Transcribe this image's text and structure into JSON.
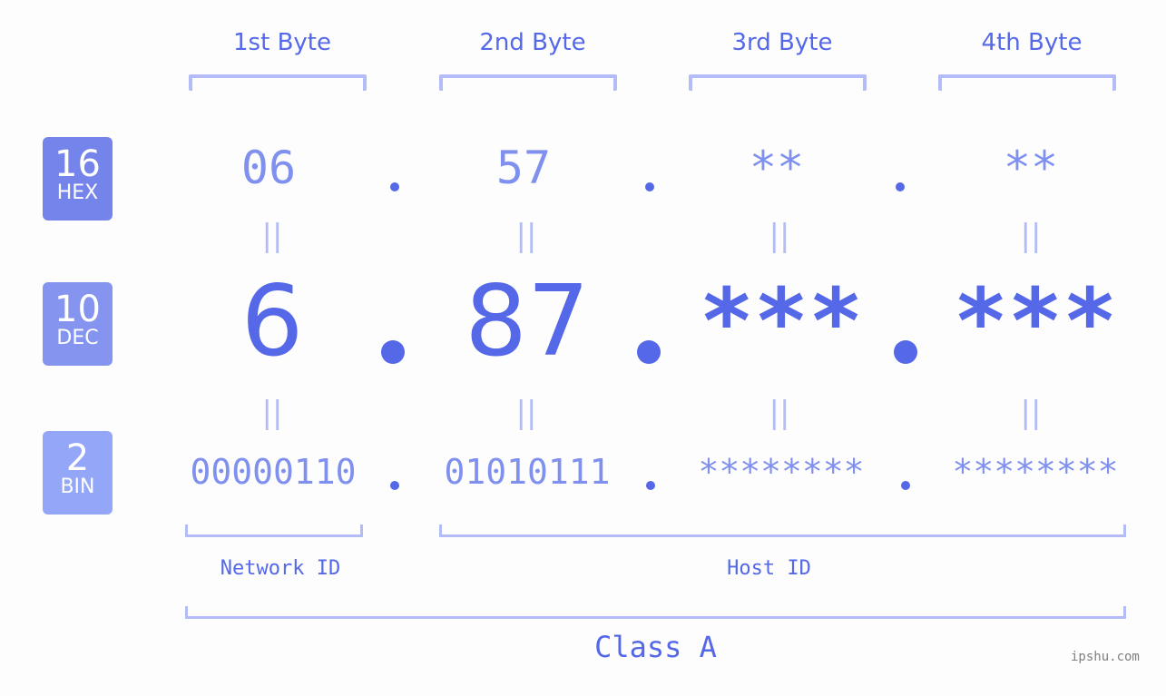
{
  "bytes": [
    {
      "label": "1st Byte",
      "hex": "06",
      "dec": "6",
      "bin": "00000110"
    },
    {
      "label": "2nd Byte",
      "hex": "57",
      "dec": "87",
      "bin": "01010111"
    },
    {
      "label": "3rd Byte",
      "hex": "**",
      "dec": "***",
      "bin": "********"
    },
    {
      "label": "4th Byte",
      "hex": "**",
      "dec": "***",
      "bin": "********"
    }
  ],
  "badges": {
    "hex": {
      "base": "16",
      "name": "HEX",
      "color": "#7584ea"
    },
    "dec": {
      "base": "10",
      "name": "DEC",
      "color": "#8594ef"
    },
    "bin": {
      "base": "2",
      "name": "BIN",
      "color": "#93a6f7"
    }
  },
  "equals_glyph": "||",
  "network_label": "Network ID",
  "host_label": "Host ID",
  "class_label": "Class A",
  "watermark": "ipshu.com",
  "colors": {
    "accent": "#5468e8",
    "light": "#8090ee",
    "bracket": "#b3bcf6"
  }
}
